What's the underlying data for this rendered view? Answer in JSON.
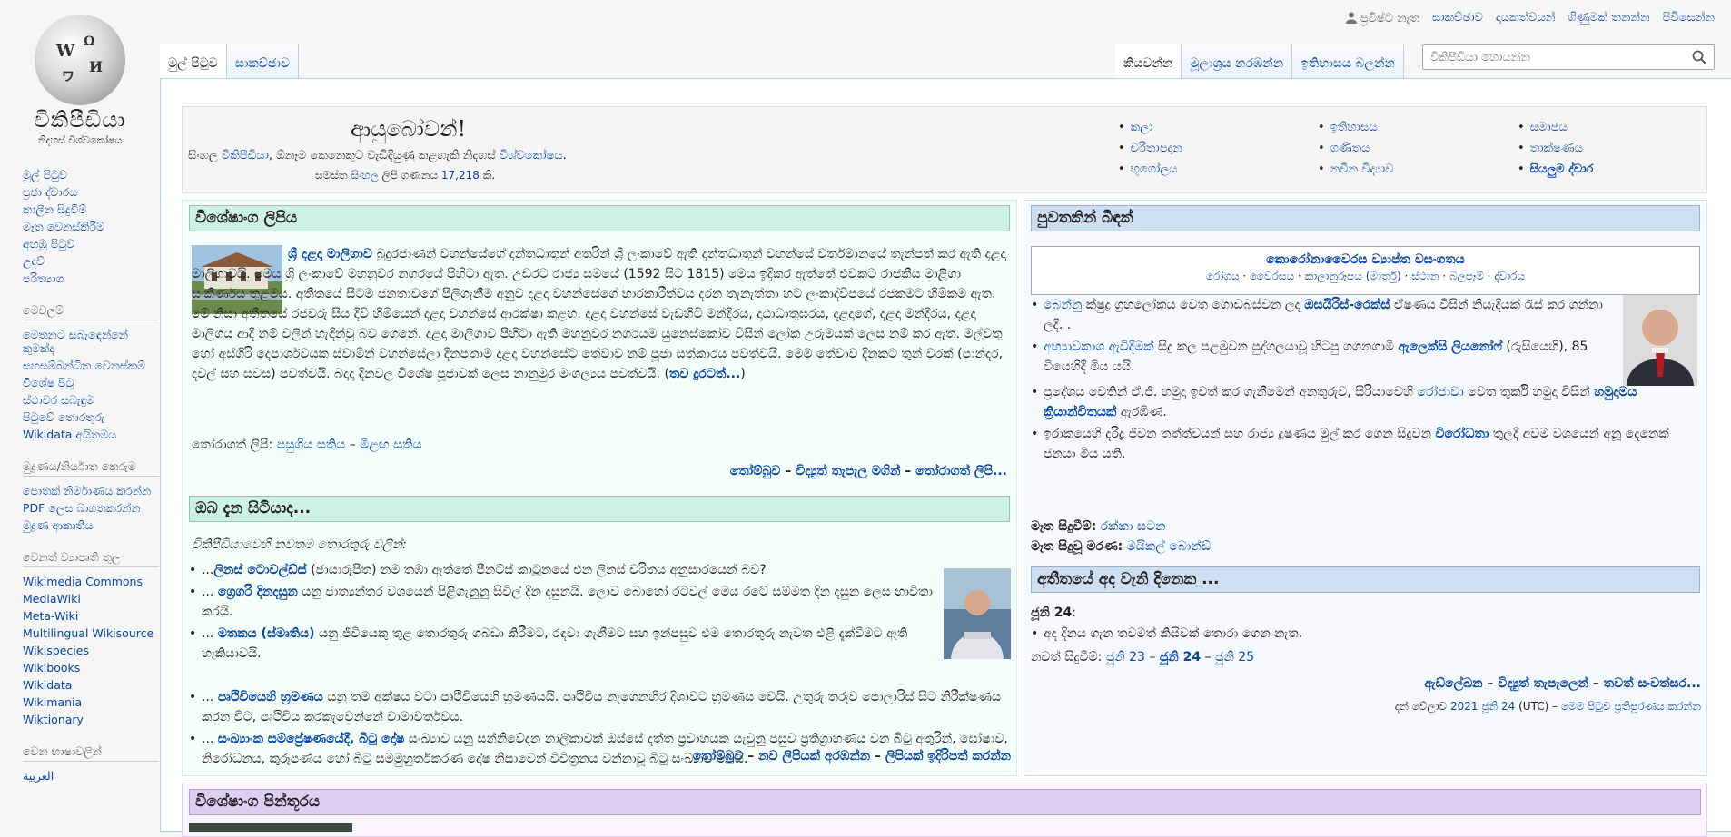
{
  "personal": {
    "not_logged_in": "ප්‍රවිෂ්ට නැත",
    "links": [
      "සාකච්ඡාව",
      "දායකත්වයන්",
      "ගිණුමක් තනන්න",
      "පිවිසෙන්න"
    ]
  },
  "logo": {
    "wordmark": "විකිපීඩියා",
    "tagline": "නිදහස් විශ්වකෝෂය"
  },
  "sidebar": {
    "main_links": [
      "මුල් පිටුව",
      "ප්‍රජා ද්වාරය",
      "කාලීන සිදුවීම්",
      "මෑත වෙනස්කිරීම්",
      "අහඹු පිටුව",
      "උදව්",
      "පරිත්‍යාග"
    ],
    "tools_heading": "මෙවලම්",
    "tools_links": [
      "මෙතනට සබැඳෙන්නේ කුමක්ද",
      "සහසම්බන්ධිත වෙනස්කම්",
      "විශේෂ පිටු",
      "ස්ථාවර සබැඳුම",
      "පිටුවේ තොරතුරු",
      "Wikidata අයිතමය"
    ],
    "print_heading": "මුද්‍රණය/නිර්යාත කෙරුම",
    "print_links": [
      "පොතක් නිර්මාණය කරන්න",
      "PDF ලෙස බාගතකරන්න",
      "මුද්‍රණ ආකෘතිය"
    ],
    "projects_heading": "වෙනත් ව්‍යාපෘති තුල",
    "projects_links": [
      "Wikimedia Commons",
      "MediaWiki",
      "Meta-Wiki",
      "Multilingual Wikisource",
      "Wikispecies",
      "Wikibooks",
      "Wikidata",
      "Wikimania",
      "Wiktionary"
    ],
    "languages_heading": "වෙන භාෂාවලින්",
    "languages_links": [
      "العربية"
    ]
  },
  "tabs": {
    "left": [
      "මුල් පිටුව",
      "සාකච්ඡාව"
    ],
    "right": [
      "කියවන්න",
      "මූලාශ්‍රය නරඹන්න",
      "ඉතිහාසය බලන්න"
    ]
  },
  "search": {
    "placeholder": "විකිපීඩියා හොයන්න"
  },
  "welcome": {
    "greeting": "ආයුබෝවන්!",
    "line_pre": "සිංහල ",
    "line_link1": "විකිපීඩියා",
    "line_mid": ", ඕනෑම කෙනෙකුට වැඩිදියුණු කළහැකි නිදහස් ",
    "line_link2": "විශ්වකෝෂය",
    "line_end": ".",
    "count_pre": "සමස්ත ",
    "count_link1": "සිංහල",
    "count_mid": " ලිපි ගණනය ",
    "count_link2": "17,218",
    "count_end": " කි.",
    "portals_col1": [
      "කලා",
      "චරිතාපදාන",
      "භූගෝලය"
    ],
    "portals_col2": [
      "ඉතිහාසය",
      "ගණිතය",
      "නවීන විද්‍යාව"
    ],
    "portals_col3": [
      "සමාජය",
      "තාක්ෂණය"
    ],
    "portals_all": "සියලුම ද්වාර"
  },
  "featured": {
    "heading": "විශේෂාංග ලිපිය",
    "lead_link": "ශ්‍රී දළදා මාලිගාව",
    "text": " බුදුරජාණන් වහන්සේගේ දන්තධාතූන් අතරින් ශ්‍රී ලංකාවේ ඇති දන්තධාතූන් වහන්සේ වර්තමානයේ තැන්පත් කර ඇති දළදා මාලිගාවයි. මෙය ශ්‍රී ලංකාවේ මහනුවර නගරයේ පිහිටා ඇත. උඩරට රාජ්‍ය සමයේ (1592 සිට 1815) මෙය ඉදිකර ඇත්තේ එවකට රාජකීය මාළිගා සංකීර්ණය තුළමය. අතීතයේ සිටම ජනතාවගේ පිලිගැනීම අනුව දළදා වහන්සේගේ භාරකාරීත්වය දරන තැනැත්තා හට ලංකාද්වීපයේ රජකමට හිමිකම ඇත. මේ නිසා අතීතයේ රජවරු සිය දිවි හිමියෙන් දළදා වහන්සේ ආරක්ෂා කළහ. දළදා වහන්සේ වැඩහිටි මන්දිරය, දාඨාධාතුඝරය, දළදාගේ, දළදා මන්දිරය, දළදා මාලිගය ආදී නම් වලින් හැඳින්වූ බව ගෙනේ. දළදා මාලිගාව පිහිටා ඇති මහනුවර නගරයම යුනෙස්කෝව විසින් ලෝක උරුමයක් ලෙස නම් කර ඇත. මල්වතු හෝ අස්ගිරි දෙපාර්ශවයක ස්වාමීන් වහන්සේලා දිනපතාම දළදා වහන්සේට තේවාව නම් පූජා සත්කාරය පවත්වයි. මෙම තේවාව දිනකට තුන් වරක් (පාන්දර, දවල් සහ සවස) පවත්වයි. බදාදා දිනවල විශේෂ පූජාවක් ලෙස නානුමුර මංගල්‍යය පවත්වයි. (",
    "more_link": "තව දුරටත්...",
    "more_end": ")",
    "recent_label": "තෝරාගත් ලිපි: ",
    "recent_a": "පසුගිය සතිය",
    "recent_sep": " – ",
    "recent_b": "මීළඟ සතිය",
    "footer_a": "තෝම්බුව",
    "footer_sep": " – ",
    "footer_b": "විද්‍යුත් තැපැල මගින්",
    "footer_sep2": " – ",
    "footer_c": "තෝරාගත් ලිපි..."
  },
  "dyk": {
    "heading": "ඔබ දැන සිටියාද...",
    "intro": "විකිපීඩියාවෙහි නවතම තොරතුරු වලින්:",
    "items": [
      {
        "pre": "...",
        "link": "ලිනස් ටොවල්ඩ්ස්",
        "post": " (ඡායාරූපිත) නම තඹා ඇත්තේ පීනට්ස් කාටූනයේ එන ලිනස් චරිතය අනුසාරයෙන් බව?"
      },
      {
        "pre": "... ",
        "link": "ග්‍රෙගරි දිනදසුන",
        "post": " යනු ජාත්‍යන්තර වශයෙන් පිළිගැනුනු සිවිල් දින දසුනයි. ලොව බොහෝ රටවල් මෙය රටේ සම්මත දින දසුන ලෙස භාවිතා කරයි."
      },
      {
        "pre": "... ",
        "link": "මතකය (ස්මෘතිය)",
        "post": " යනු ජීවියෙකු තුළ තොරතුරු ගබඩා කිරීමට, රඳවා ගැනීමට සහ ඉන්පසුව එම තොරතුරු නැවත එළි දැක්වීමට ඇති හැකියාවයි."
      },
      {
        "pre": "... ",
        "link": "පෘථිවියෙහි භ්‍රමණය",
        "post": " යනු තම අක්ෂය වටා පෘථිවියෙහි භ්‍රමණයයි. පෘථිවිය නැගෙනහිර දිශාවට භ්‍රමණය වෙයි. උතුරු තරුව පොලාරිස් සිට නිරීක්ෂණය කරන විට, පෘථිවිය කරකැවෙන්නේ වාමාවර්තවය."
      },
      {
        "pre": "... ",
        "link": "සංඛ්‍යාංක සම්ප්‍රේෂණයේදී, බිටු දෝෂ",
        "post": " සංඛ්‍යාව යනු සන්නිවේදන නාලිකාවක් ඔස්සේ දත්ත ප්‍රවාහයක යැවුනු පසුව ප්‍රතිග්‍රාහණය වන බිටු අතුරින්, ඝෝෂාව, නිරෝධනය, කුරූපණය හෝ බිටු සමමුහුර්තකරණ දෝෂ නිසාවෙන් විචිත්‍රනය වන්නාවූ බිටු සංඛ්‍යාව වෙයි."
      }
    ],
    "footer_a": "තෝම්බුව",
    "footer_sep": " – ",
    "footer_b": "නව ලිපියක් අරඹන්න",
    "footer_sep2": " – ",
    "footer_c": "ලිපියක් ඉදිරිපත් කරන්න"
  },
  "news": {
    "heading": "පුවතකින් බිඳක්",
    "covid_title": "කොරෝනාවෛරස ව්‍යාප්ත වසංගතය",
    "covid_links": [
      "රෝගය",
      "වෛරසය",
      "කාලානුරූපය (මාර්තු)",
      "ස්ථාන",
      "බලපෑම්",
      "ද්වාරය"
    ],
    "items": [
      {
        "a": "බෙන්නු",
        "b": " ක්ෂුද්‍ර ග්‍රහලෝකය වෙත ගොඩබස්වන ලද ",
        "c": "ඔසයිරිස්-රෙක්ස්",
        "d": " ඒෂණය විසින් නියැදියක් රැස් කර ගන්නා ලදි. ."
      },
      {
        "a": "අභ්‍යාවකාශ ඇවිදීමක්",
        "b": " සිදු කල පළමුවන පුද්ගලයාවූ හිටපු ගගනගාමී ",
        "c": "ඇලෙක්සි ලියනෝෆ්",
        "d": " (රුසියෙහි), 85 වියෙහිදී මිය යයි."
      },
      {
        "a": "",
        "b": "ප්‍රදේශය වෙතින් ඒ.ජී. හමුදා ඉවත් කර ගැනීමෙන් අනතුරුව, සිරියාවෙහි ",
        "c2": "රෝජාවා",
        "b2": " වෙත තුර්කි හමුදා විසින් ",
        "c": "හමුදාමය ක්‍රියාන්විතයක්",
        "d": " ඇරඹිණ."
      },
      {
        "a": "",
        "b": "ඉරාකයෙහි දරිද්‍ර ජීවන තත්ත්වයන් සහ රාජ්‍ය දූෂණය මුල් කර ගෙන සිදුවන ",
        "c": "විරෝධතා",
        "d": " තුලදී අවම වශයෙන් අනූ දෙනෙක් ජනයා මිය යති."
      }
    ],
    "ongoing_label": "මෑත සිදුවීම්:",
    "ongoing_link": " රක්කා සටන",
    "deaths_label": "මෑත සිදුවූ මරණ:",
    "deaths_link": " මයිකල් බොන්ඩ්"
  },
  "otd": {
    "heading": "අතීතයේ අද වැනි දිනෙක ...",
    "date": "ජූනි 24",
    "date_colon": ":",
    "item": "අද දිනය ගැන තවමත් කිසිවක් තොරා ගෙන නැත.",
    "recent_label": "නවත් සිදුවීම්: ",
    "day_a": "ජූනි 23",
    "sep": " – ",
    "day_b": "ජූනි 24",
    "sep2": " – ",
    "day_c": "ජූනි 25",
    "footer_a": "ඇඩ්ලේඛන",
    "footer_sep": " – ",
    "footer_b": "විද්‍යුත් තැපැලෙන්",
    "footer_sep2": " – ",
    "footer_c": "තවත් සංවත්සර...",
    "time_pre": "දන් වේලාව ",
    "time_link1": "2021",
    "time_space": " ",
    "time_link2": "ජූනි 24",
    "time_mid": " (UTC) – ",
    "time_link3": "මෙම පිටුව ප්‍රතිපූරණය කරන්න"
  },
  "picture": {
    "heading": "විශේෂාංග පින්තූරය"
  },
  "colors": {
    "link": "#0645ad",
    "featured_bg": "#f5fffa",
    "featured_head": "#cef2e0",
    "news_bg": "#f5faff",
    "news_head": "#cedff2",
    "picture_head": "#ddcef2"
  }
}
